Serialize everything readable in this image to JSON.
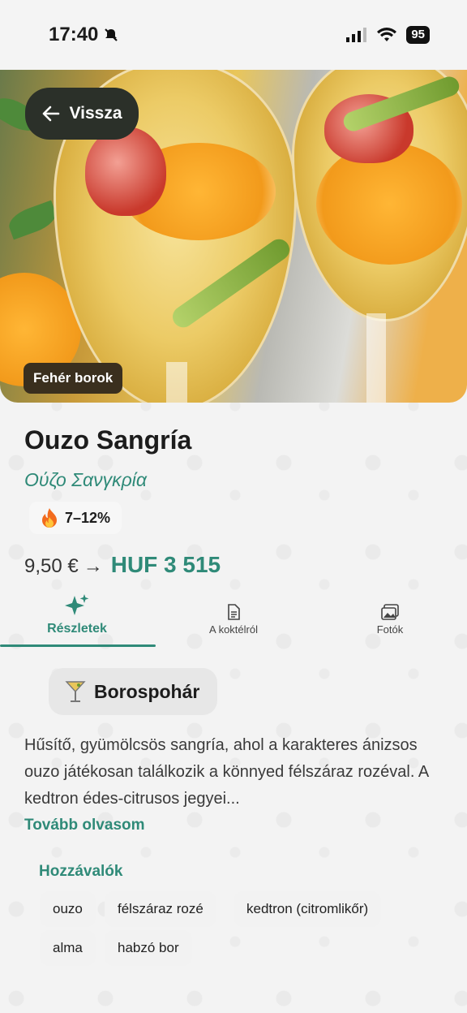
{
  "status_bar": {
    "time": "17:40",
    "battery": "95"
  },
  "hero": {
    "back_label": "Vissza",
    "category": "Fehér borok"
  },
  "drink": {
    "title": "Ouzo Sangría",
    "subtitle": "Ούζο Σανγκρία",
    "abv": "7–12%",
    "price_eur": "9,50 €",
    "price_arrow": "→",
    "price_huf": "HUF 3 515"
  },
  "tabs": [
    {
      "label": "Részletek",
      "icon": "sparkles-icon",
      "active": true
    },
    {
      "label": "A koktélról",
      "icon": "document-icon",
      "active": false
    },
    {
      "label": "Fotók",
      "icon": "photos-icon",
      "active": false
    }
  ],
  "glass": {
    "label": "Borospohár",
    "icon": "cocktail-glass-icon"
  },
  "description": "Hűsítő, gyümölcsös sangría, ahol a karakteres ánizsos ouzo játékosan találkozik a könnyed félszáraz rozéval. A kedtron édes-citrusos jegyei...",
  "read_more": "Tovább olvasom",
  "ingredients": {
    "title": "Hozzávalók",
    "items": [
      "ouzo",
      "félszáraz rozé",
      "kedtron (citromlikőr)",
      "alma",
      "habzó bor"
    ]
  },
  "colors": {
    "accent": "#2f8a78",
    "back_button_bg": "#2b3029",
    "badge_bg": "#3a2f1e"
  }
}
